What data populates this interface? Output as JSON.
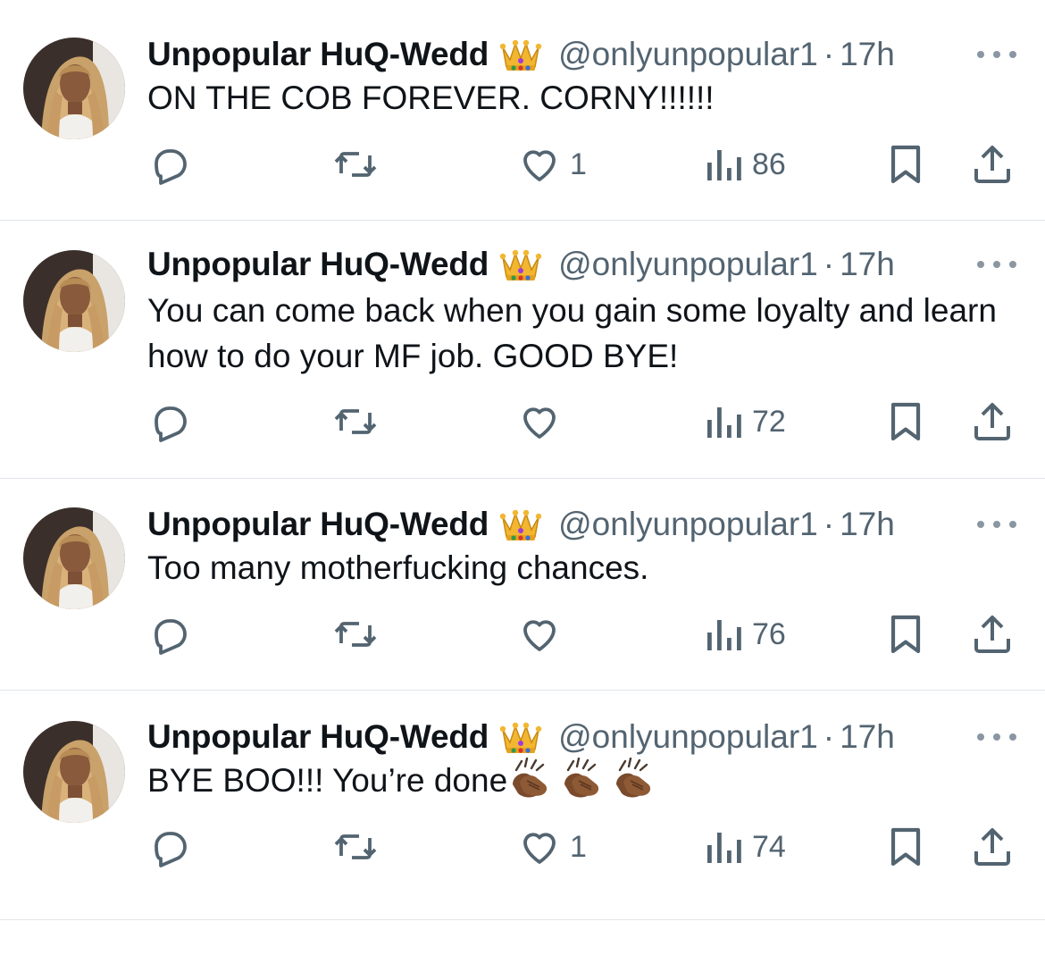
{
  "colors": {
    "text": "#0f1419",
    "secondary": "#536471",
    "divider": "#e1e6ea",
    "icon": "#536471"
  },
  "tweets": [
    {
      "author_name": "Unpopular HuQ-Wedd",
      "badge_icon": "crown-emoji",
      "handle": "@onlyunpopular1",
      "separator": "·",
      "time": "17h",
      "text": "ON THE COB FOREVER. CORNY!!!!!!",
      "emoji_suffix": [],
      "replies": "",
      "reposts": "",
      "likes": "1",
      "views": "86"
    },
    {
      "author_name": "Unpopular HuQ-Wedd",
      "badge_icon": "crown-emoji",
      "handle": "@onlyunpopular1",
      "separator": "·",
      "time": "17h",
      "text": "You can come back when you gain some loyalty and learn how to do your MF job. GOOD BYE!",
      "emoji_suffix": [],
      "replies": "",
      "reposts": "",
      "likes": "",
      "views": "72"
    },
    {
      "author_name": "Unpopular HuQ-Wedd",
      "badge_icon": "crown-emoji",
      "handle": "@onlyunpopular1",
      "separator": "·",
      "time": "17h",
      "text": "Too many motherfucking chances.",
      "emoji_suffix": [],
      "replies": "",
      "reposts": "",
      "likes": "",
      "views": "76"
    },
    {
      "author_name": "Unpopular HuQ-Wedd",
      "badge_icon": "crown-emoji",
      "handle": "@onlyunpopular1",
      "separator": "·",
      "time": "17h",
      "text": "BYE BOO!!! You’re done",
      "emoji_suffix": [
        "clapping-hands-emoji",
        "clapping-hands-emoji",
        "clapping-hands-emoji"
      ],
      "replies": "",
      "reposts": "",
      "likes": "1",
      "views": "74"
    }
  ],
  "icons": {
    "reply": "reply-icon",
    "repost": "repost-icon",
    "like": "heart-icon",
    "views": "views-icon",
    "bookmark": "bookmark-icon",
    "share": "share-icon",
    "more": "more-icon"
  }
}
